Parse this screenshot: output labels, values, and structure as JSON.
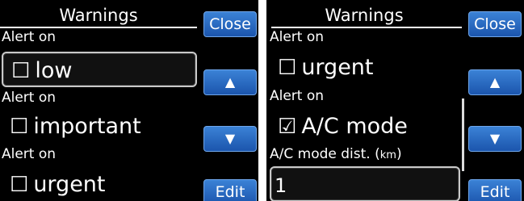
{
  "left": {
    "title": "Warnings",
    "rows": [
      {
        "label": "Alert on",
        "value": "low",
        "check": "☐"
      },
      {
        "label": "Alert on",
        "value": "important",
        "check": "☐"
      },
      {
        "label": "Alert on",
        "value": "urgent",
        "check": "☐"
      }
    ],
    "buttons": {
      "close": "Close",
      "up": "▲",
      "down": "▼",
      "edit": "Edit"
    }
  },
  "right": {
    "title": "Warnings",
    "rows": [
      {
        "label": "Alert on",
        "value": "urgent",
        "check": "☐"
      },
      {
        "label": "Alert on",
        "value": "A/C mode",
        "check": "☑"
      }
    ],
    "dist_label": "A/C mode dist. (",
    "dist_unit": "km",
    "dist_suffix": ")",
    "dist_value": "1",
    "buttons": {
      "close": "Close",
      "up": "▲",
      "down": "▼",
      "edit": "Edit"
    }
  },
  "colors": {
    "background": "#000000",
    "button": "#2a6ac6",
    "text": "#ffffff"
  }
}
